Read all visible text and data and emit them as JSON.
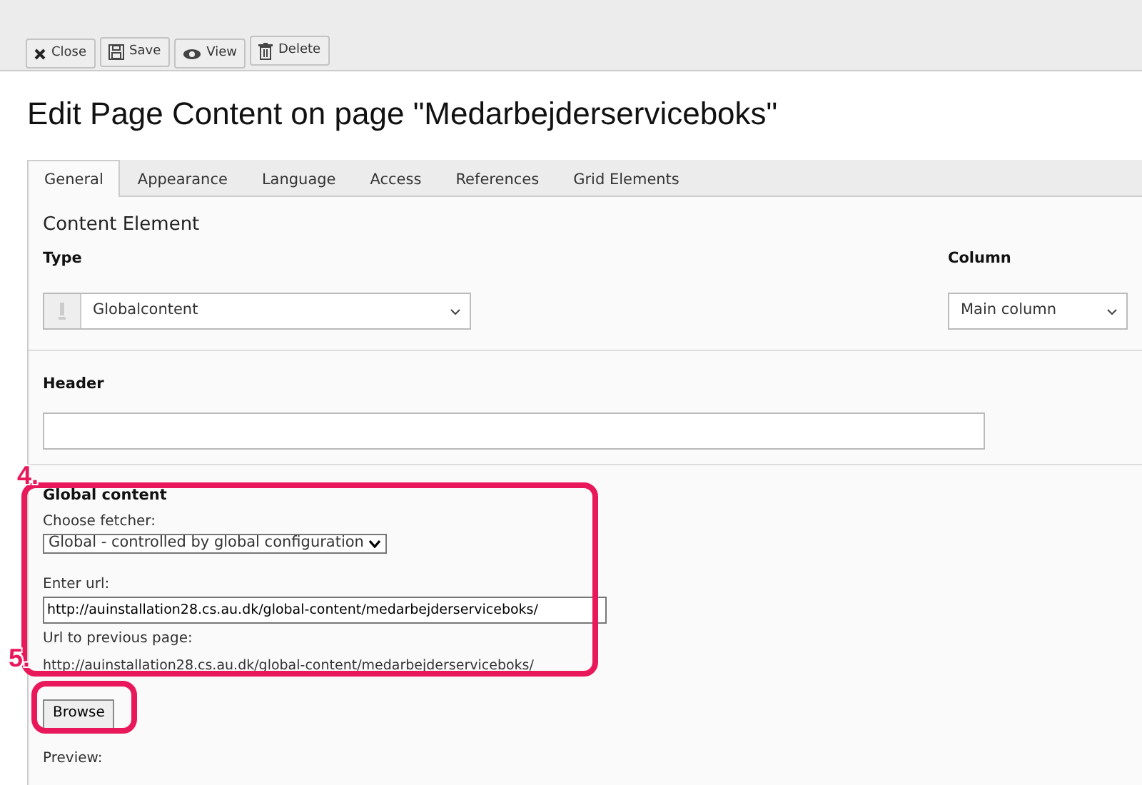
{
  "toolbar": [
    {
      "label": "Close",
      "kind": "close"
    },
    {
      "label": "Save",
      "kind": "save"
    },
    {
      "label": "View",
      "kind": "view"
    },
    {
      "label": "Delete",
      "kind": "delete"
    }
  ],
  "title": "Edit Page Content on page \"Medarbejderserviceboks\"",
  "tabs": [
    {
      "label": "General",
      "selected": true
    },
    {
      "label": "Appearance",
      "selected": false
    },
    {
      "label": "Language",
      "selected": false
    },
    {
      "label": "Access",
      "selected": false
    },
    {
      "label": "References",
      "selected": false
    },
    {
      "label": "Grid Elements",
      "selected": false
    }
  ],
  "content_element": {
    "heading": "Content Element",
    "type_label": "Type",
    "type_value": "Globalcontent",
    "column_label": "Column",
    "column_value": "Main column"
  },
  "header": {
    "label": "Header"
  },
  "global_content": {
    "heading": "Global content",
    "fetcher_label": "Choose fetcher:",
    "fetcher_value": "Global - controlled by global configuration",
    "url_label": "Enter url:",
    "url_value": "http://auinstallation28.cs.au.dk/global-content/medarbejderserviceboks/",
    "previous_label": "Url to previous page:",
    "previous_url": "http://auinstallation28.cs.au.dk/global-content/medarbejderserviceboks/",
    "browse": "Browse",
    "preview_label": "Preview:"
  },
  "callouts": [
    {
      "label": "4."
    },
    {
      "label": "5."
    }
  ]
}
